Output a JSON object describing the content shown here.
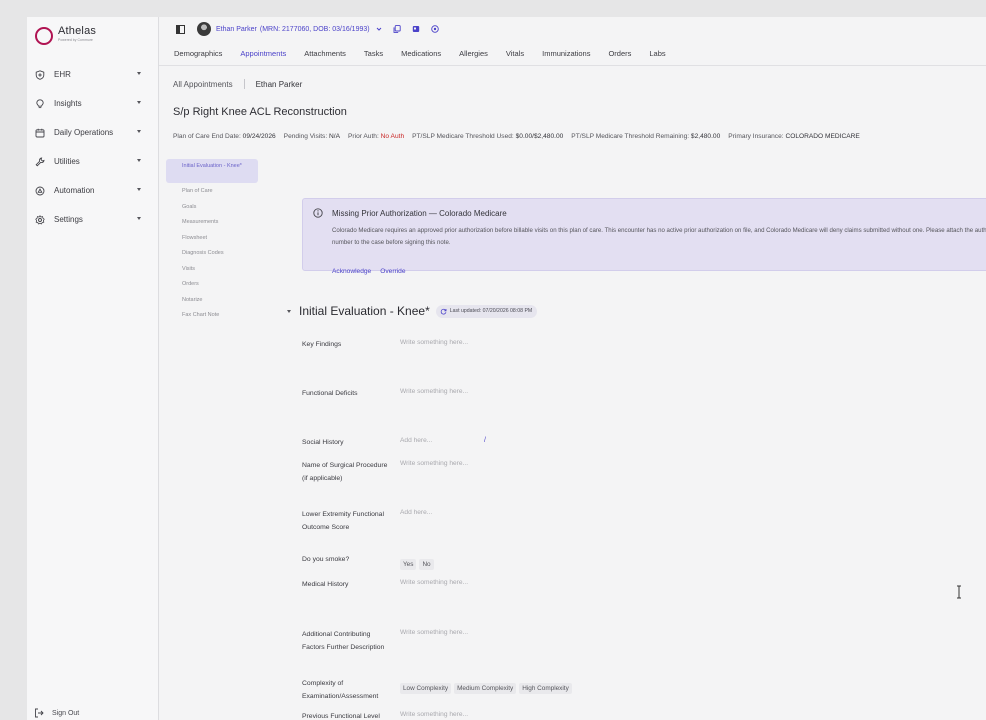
{
  "brand": {
    "name": "Athelas",
    "tagline": "Powered by Commure"
  },
  "sidebar": {
    "items": [
      {
        "label": "EHR",
        "icon": "shield-plus-icon"
      },
      {
        "label": "Insights",
        "icon": "lightbulb-icon"
      },
      {
        "label": "Daily Operations",
        "icon": "calendar-icon"
      },
      {
        "label": "Utilities",
        "icon": "wrench-icon"
      },
      {
        "label": "Automation",
        "icon": "automation-icon"
      },
      {
        "label": "Settings",
        "icon": "gear-icon"
      }
    ],
    "sign_out": "Sign Out"
  },
  "patient": {
    "name": "Ethan Parker",
    "meta": "(MRN: 2177060, DOB: 03/16/1993)"
  },
  "tabs": [
    "Demographics",
    "Appointments",
    "Attachments",
    "Tasks",
    "Medications",
    "Allergies",
    "Vitals",
    "Immunizations",
    "Orders",
    "Labs"
  ],
  "active_tab": "Appointments",
  "breadcrumb": {
    "root": "All Appointments",
    "current": "Ethan Parker"
  },
  "plan": {
    "title": "S/p Right Knee ACL Reconstruction",
    "meta": [
      {
        "k": "Plan of Care End Date:",
        "v": "09/24/2026",
        "red": false
      },
      {
        "k": "Pending Visits:",
        "v": "N/A",
        "red": false
      },
      {
        "k": "Prior Auth:",
        "v": "No Auth",
        "red": true
      },
      {
        "k": "PT/SLP Medicare Threshold Used:",
        "v": "$0.00/$2,480.00",
        "red": false
      },
      {
        "k": "PT/SLP Medicare Threshold Remaining:",
        "v": "$2,480.00",
        "red": false
      },
      {
        "k": "Primary Insurance:",
        "v": "COLORADO MEDICARE",
        "red": false
      }
    ]
  },
  "subnav": [
    "Initial Evaluation - Knee*",
    "Plan of Care",
    "Goals",
    "Measurements",
    "Flowsheet",
    "Diagnosis Codes",
    "Visits",
    "Orders",
    "Notarize",
    "Fax Chart Note"
  ],
  "alert": {
    "title": "Missing Prior Authorization — Colorado Medicare",
    "body": "Colorado Medicare requires an approved prior authorization before billable visits on this plan of care. This encounter has no active prior authorization on file, and Colorado Medicare will deny claims submitted without one. Please attach the authorization number to the case before signing this note.",
    "actions": [
      "Acknowledge",
      "Override"
    ]
  },
  "section": {
    "title": "Initial Evaluation - Knee*",
    "updated": "Last updated: 07/20/2026 08:08 PM"
  },
  "fields": [
    {
      "label": "Key Findings",
      "value": "Write something here..."
    },
    {
      "label": "Functional Deficits",
      "value": "Write something here..."
    },
    {
      "label": "Social History",
      "value": "Add here..."
    },
    {
      "label": "Name of Surgical Procedure (if applicable)",
      "value": "Write something here..."
    },
    {
      "label": "Lower Extremity Functional Outcome Score",
      "value": "Add here..."
    },
    {
      "label": "Do you smoke?",
      "options": [
        "Yes",
        "No"
      ]
    },
    {
      "label": "Medical History",
      "value": "Write something here..."
    },
    {
      "label": "Additional Contributing Factors Further Description",
      "value": "Write something here..."
    },
    {
      "label": "Complexity of Examination/Assessment",
      "options": [
        "Low Complexity",
        "Medium Complexity",
        "High Complexity"
      ]
    },
    {
      "label": "Previous Functional Level",
      "value": "Write something here..."
    }
  ],
  "slash_hint": "/",
  "colors": {
    "brand": "#b01352",
    "accent": "#4b42c9",
    "danger": "#c92727",
    "alert_bg": "#e3dff2"
  }
}
